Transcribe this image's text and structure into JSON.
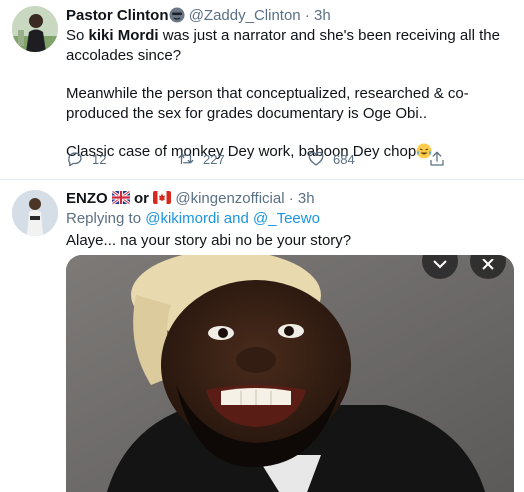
{
  "tweets": [
    {
      "author_name": "Pastor Clinton",
      "name_emoji": "sunglasses-emoji",
      "handle": "@Zaddy_Clinton",
      "separator": "·",
      "time": "3h",
      "text": {
        "line1_pre": "So ",
        "line1_bold": "kiki Mordi",
        "line1_post": " was just a narrator and she's been receiving all the accolades since?",
        "para2": "Meanwhile the person that conceptualized, researched & co-produced the sex for grades documentary is Oge Obi..",
        "para3": "Classic case of monkey Dey work, baboon Dey chop",
        "para3_emoji": "crying-laughing-emoji"
      },
      "actions": {
        "replies": "12",
        "retweets": "227",
        "likes": "684"
      }
    },
    {
      "author_name": "ENZO",
      "name_or": "or",
      "flags": [
        "uk-flag-icon",
        "canada-flag-icon"
      ],
      "handle": "@kingenzofficial",
      "separator": "·",
      "time": "3h",
      "replying_prefix": "Replying to ",
      "replying_user1": "@kikimordi",
      "replying_and": " and ",
      "replying_user2": "@_Teewo",
      "text": "Alaye... na your story abi no be your story?"
    }
  ],
  "colors": {
    "text": "#0f1419",
    "muted": "#5b7083",
    "link": "#1b95e0",
    "divider": "#e6ecf0"
  }
}
